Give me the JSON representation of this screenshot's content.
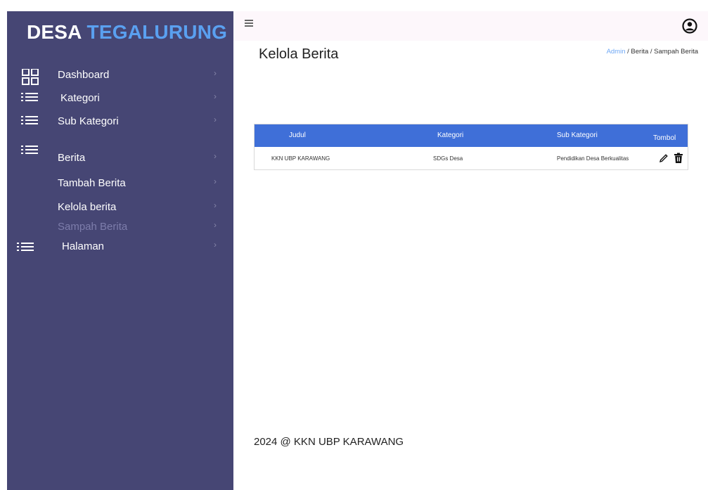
{
  "brand": {
    "word1": "DESA",
    "word2": "TEGALURUNG"
  },
  "sidebar": {
    "items": [
      {
        "label": "Dashboard",
        "icon": "grid-icon"
      },
      {
        "label": "Kategori",
        "icon": "list-icon"
      },
      {
        "label": "Sub Kategori",
        "icon": "list-icon"
      },
      {
        "label": "Berita",
        "icon": "list-icon"
      },
      {
        "label": "Tambah Berita"
      },
      {
        "label": "Kelola berita"
      },
      {
        "label": "Sampah Berita",
        "active": true
      },
      {
        "label": "Halaman",
        "icon": "list-icon"
      }
    ],
    "chevron": "›"
  },
  "topbar": {
    "menu_icon": "hamburger-icon",
    "user_icon": "user-circle-icon"
  },
  "page": {
    "title": "Kelola Berita",
    "breadcrumb": {
      "link": "Admin",
      "rest": " / Berita / Sampah Berita"
    }
  },
  "table": {
    "headers": [
      "Judul",
      "Kategori",
      "Sub Kategori",
      "Tombol"
    ],
    "rows": [
      {
        "judul": "KKN UBP KARAWANG",
        "kategori": "SDGs Desa",
        "sub_kategori": "Pendidikan Desa Berkualitas"
      }
    ]
  },
  "footer": {
    "text": "2024 @ KKN UBP KARAWANG"
  },
  "colors": {
    "sidebar": "#464674",
    "accent": "#5aa0f0",
    "table_header": "#3f6fd8",
    "topbar": "#fdf7fb"
  }
}
